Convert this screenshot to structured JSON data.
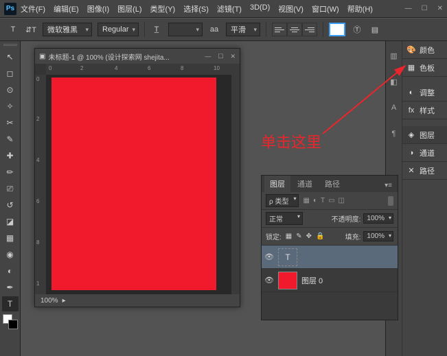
{
  "app": {
    "logo": "Ps"
  },
  "menu": [
    "文件(F)",
    "编辑(E)",
    "图像(I)",
    "图层(L)",
    "类型(Y)",
    "选择(S)",
    "滤镜(T)",
    "3D(D)",
    "视图(V)",
    "窗口(W)",
    "帮助(H)"
  ],
  "options": {
    "font": "微软雅黑",
    "weight": "Regular",
    "size": "",
    "aa_label": "aa",
    "aa": "平滑"
  },
  "doc": {
    "title": "未标题-1 @ 100% (设计探索网 shejita...",
    "zoom": "100%",
    "ruler_h": [
      "0",
      "2",
      "4",
      "6",
      "8",
      "10"
    ],
    "ruler_v": [
      "0",
      "2",
      "4",
      "6",
      "8",
      "1"
    ],
    "canvas_color": "#f01a2c"
  },
  "annotation": "单击这里",
  "panels": {
    "color": "颜色",
    "swatches": "色板",
    "adjust": "调整",
    "styles": "样式",
    "layers": "图层",
    "channels": "通道",
    "paths": "路径"
  },
  "layers_panel": {
    "tabs": [
      "图层",
      "通道",
      "路径"
    ],
    "kind_label": "类型",
    "search": "ρ",
    "blend": "正常",
    "opacity_label": "不透明度:",
    "opacity_val": "100%",
    "lock_label": "锁定:",
    "fill_label": "填充:",
    "fill_val": "100%",
    "layers": [
      {
        "visible": true,
        "type": "text",
        "name": "",
        "thumb_letter": "T"
      },
      {
        "visible": true,
        "type": "raster",
        "name": "图层 0",
        "thumb_color": "#f01a2c"
      }
    ]
  }
}
